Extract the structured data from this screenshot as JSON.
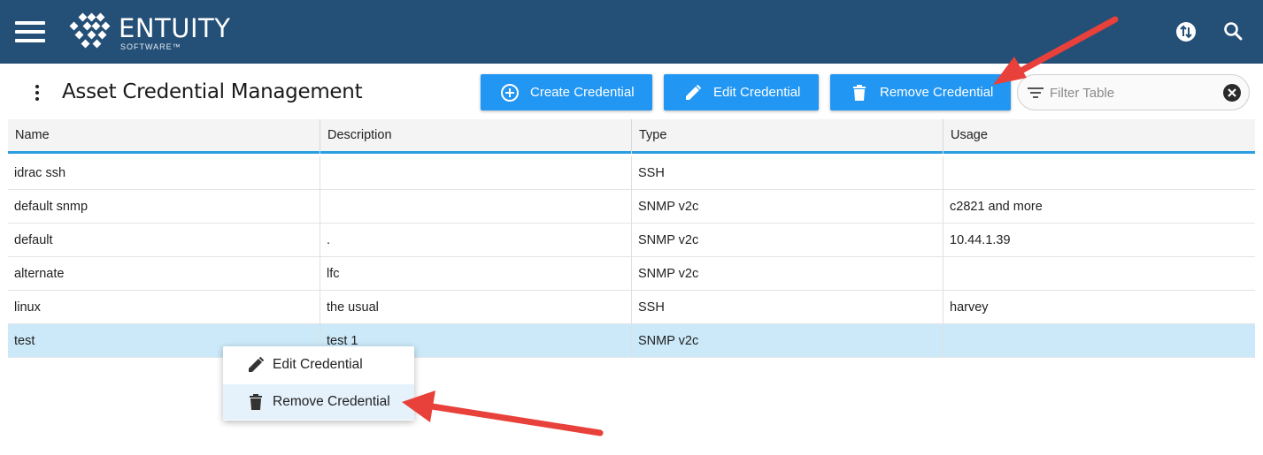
{
  "header": {
    "brand": "ENTUITY",
    "brand_sub": "SOFTWARE™",
    "background": "#244f77",
    "icons": [
      "menu-icon",
      "sync-icon",
      "search-icon"
    ]
  },
  "page": {
    "title": "Asset Credential Management"
  },
  "toolbar": {
    "create_label": "Create Credential",
    "edit_label": "Edit Credential",
    "remove_label": "Remove Credential",
    "filter_placeholder": "Filter Table",
    "accent": "#2196f3"
  },
  "table": {
    "columns": [
      "Name",
      "Description",
      "Type",
      "Usage"
    ],
    "rows": [
      {
        "name": "idrac ssh",
        "description": "",
        "type": "SSH",
        "usage": ""
      },
      {
        "name": "default snmp",
        "description": "",
        "type": "SNMP v2c",
        "usage": "c2821 and more"
      },
      {
        "name": "default",
        "description": ".",
        "type": "SNMP v2c",
        "usage": "10.44.1.39"
      },
      {
        "name": "alternate",
        "description": "lfc",
        "type": "SNMP v2c",
        "usage": ""
      },
      {
        "name": "linux",
        "description": "the usual",
        "type": "SSH",
        "usage": "harvey"
      },
      {
        "name": "test",
        "description": "test 1",
        "type": "SNMP v2c",
        "usage": ""
      }
    ],
    "selected_row": 5,
    "selected_color": "#cbe9f8"
  },
  "context_menu": {
    "items": [
      {
        "label": "Edit Credential",
        "icon": "pencil-icon"
      },
      {
        "label": "Remove Credential",
        "icon": "trash-icon"
      }
    ],
    "highlighted_item": 1
  },
  "annotations": {
    "arrow_color": "#e8403a"
  }
}
